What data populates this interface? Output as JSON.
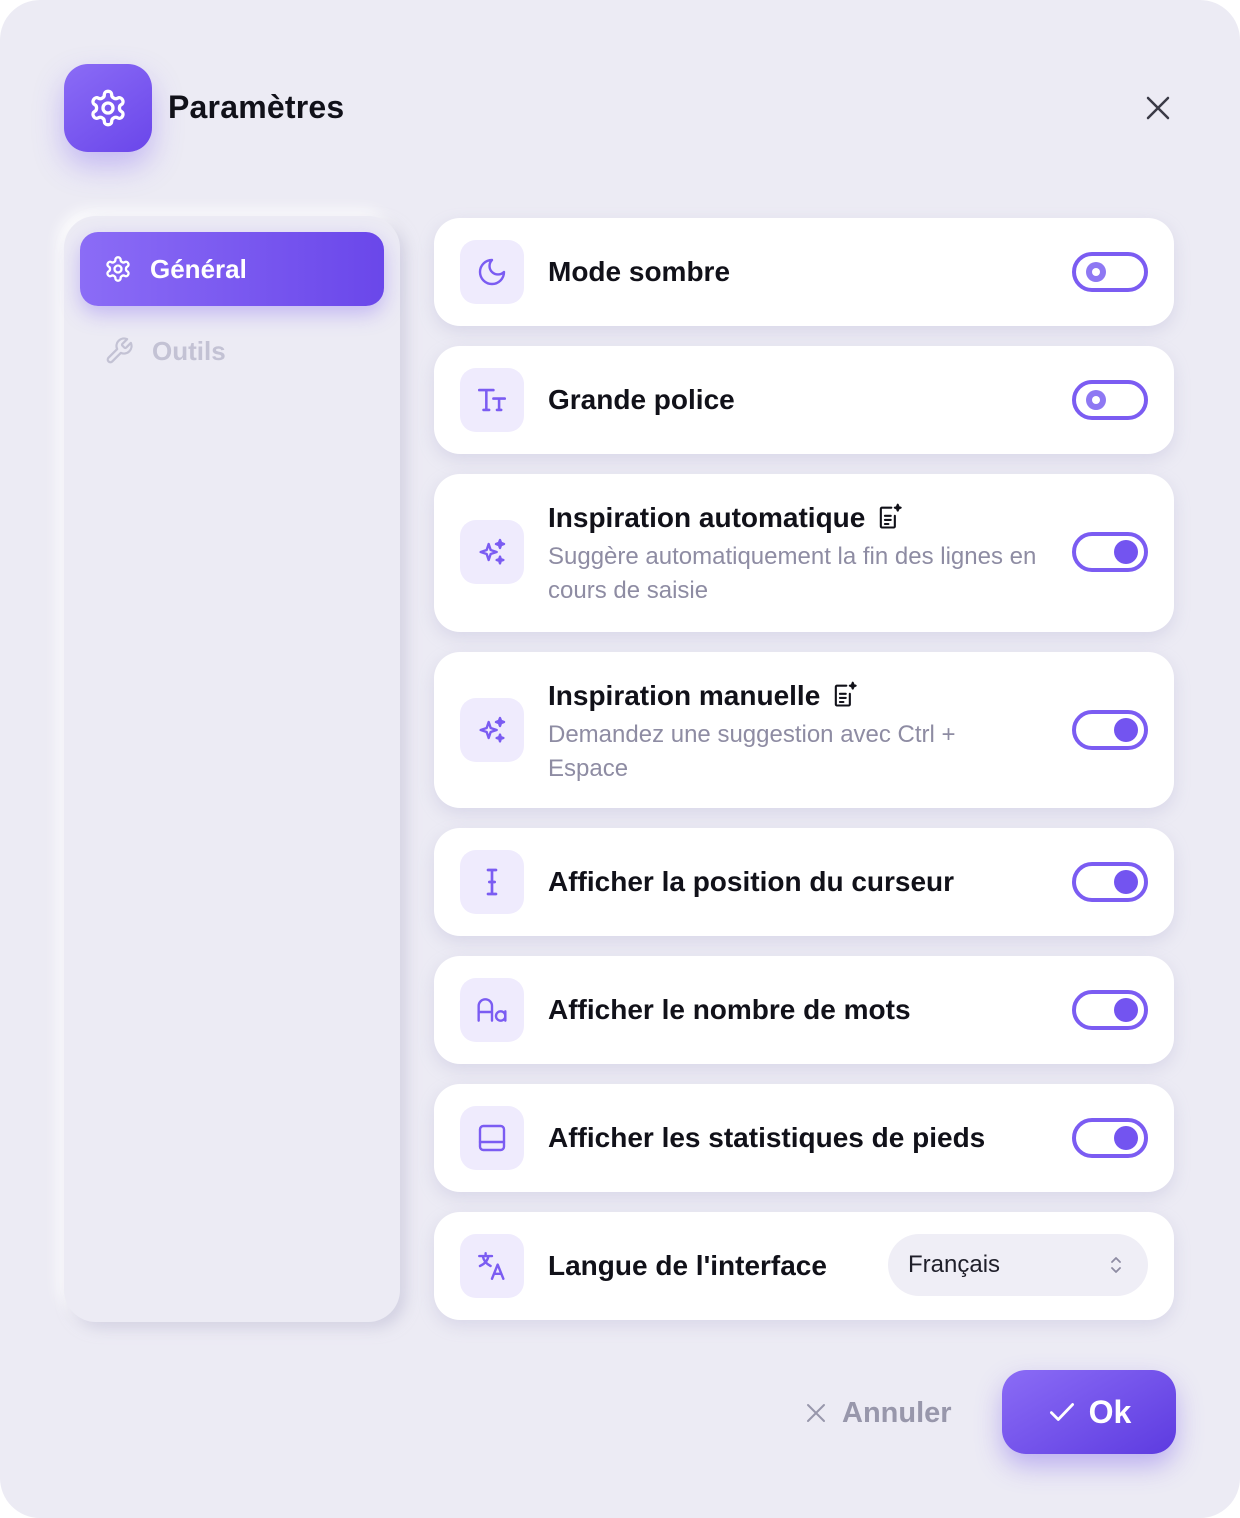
{
  "dialog": {
    "title": "Paramètres",
    "icon": "gear-icon",
    "accent_color": "#7b5cf2"
  },
  "sidebar": {
    "items": [
      {
        "label": "Général",
        "icon": "gear-icon",
        "active": true
      },
      {
        "label": "Outils",
        "icon": "wrench-icon",
        "active": false
      }
    ]
  },
  "settings": [
    {
      "label": "Mode sombre",
      "icon": "moon-icon",
      "enabled": false
    },
    {
      "label": "Grande police",
      "icon": "text-size-icon",
      "enabled": false
    },
    {
      "label": "Inspiration automatique",
      "icon": "sparkles-icon",
      "badge": "ai-document-icon",
      "description": "Suggère automatiquement la fin des lignes en cours de saisie",
      "enabled": true
    },
    {
      "label": "Inspiration manuelle",
      "icon": "sparkles-icon",
      "badge": "ai-document-icon",
      "description": "Demandez une suggestion avec Ctrl + Espace",
      "enabled": true
    },
    {
      "label": "Afficher la position du curseur",
      "icon": "text-cursor-icon",
      "enabled": true
    },
    {
      "label": "Afficher le nombre de mots",
      "icon": "font-case-icon",
      "enabled": true
    },
    {
      "label": "Afficher les statistiques de pieds",
      "icon": "panel-bottom-icon",
      "enabled": true
    },
    {
      "label": "Langue de l'interface",
      "icon": "languages-icon",
      "value": "Français"
    }
  ],
  "footer": {
    "cancel_label": "Annuler",
    "ok_label": "Ok"
  }
}
